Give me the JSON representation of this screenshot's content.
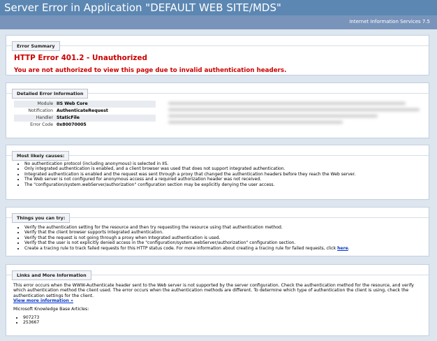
{
  "header": {
    "title": "Server Error in Application \"DEFAULT WEB SITE/MDS\""
  },
  "server_version": "Internet Information Services 7.5",
  "error_summary": {
    "tab": "Error Summary",
    "heading": "HTTP Error 401.2 - Unauthorized",
    "message": "You are not authorized to view this page due to invalid authentication headers."
  },
  "detailed": {
    "tab": "Detailed Error Information",
    "rows": [
      {
        "key": "Module",
        "value": "IIS Web Core"
      },
      {
        "key": "Notification",
        "value": "AuthenticateRequest"
      },
      {
        "key": "Handler",
        "value": "StaticFile"
      },
      {
        "key": "Error Code",
        "value": "0x80070005"
      }
    ]
  },
  "causes": {
    "tab": "Most likely causes:",
    "items": [
      "No authentication protocol (including anonymous) is selected in IIS.",
      "Only integrated authentication is enabled, and a client browser was used that does not support integrated authentication.",
      "Integrated authentication is enabled and the request was sent through a proxy that changed the authentication headers before they reach the Web server.",
      "The Web server is not configured for anonymous access and a required authorization header was not received.",
      "The \"configuration/system.webServer/authorization\" configuration section may be explicitly denying the user access."
    ]
  },
  "try": {
    "tab": "Things you can try:",
    "items": [
      "Verify the authentication setting for the resource and then try requesting the resource using that authentication method.",
      "Verify that the client browser supports Integrated authentication.",
      "Verify that the request is not going through a proxy when Integrated authentication is used.",
      "Verify that the user is not explicitly denied access in the \"configuration/system.webServer/authorization\" configuration section."
    ],
    "last_item": "Create a tracing rule to track failed requests for this HTTP status code. For more information about creating a tracing rule for failed requests, click ",
    "last_link": "here",
    "last_end": "."
  },
  "links": {
    "tab": "Links and More Information",
    "paragraph": "This error occurs when the WWW-Authenticate header sent to the Web server is not supported by the server configuration. Check the authentication method for the resource, and verify which authentication method the client used. The error occurs when the authentication methods are different. To determine which type of authentication the client is using, check the authentication settings for the client.",
    "view_more": "View more information »",
    "kb_label": "Microsoft Knowledge Base Articles:",
    "kb_items": [
      "907273",
      "253667"
    ]
  }
}
